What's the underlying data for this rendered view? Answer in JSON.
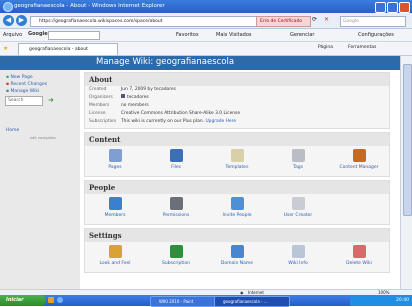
{
  "browser": {
    "title": "geografianaescola - About - Windows Internet Explorer",
    "url": "https://geografianaescola.wikispaces.com/space/about",
    "cert_error": "Erro de Certificado",
    "search_placeholder": "Google",
    "google_label": "Google",
    "tab_label": "geografianaescola - about",
    "favoritos": "Favoritos",
    "mais_visitados": "Mais Visitados",
    "gerenciar": "Gerenciar",
    "configuracoes": "Configurações",
    "arquivo": "Arquivo",
    "pagina": "Página",
    "ferramentas": "Ferramentas"
  },
  "wiki": {
    "header_title": "Manage Wiki: geografianaescola",
    "sidebar": {
      "items": [
        {
          "label": "New Page"
        },
        {
          "label": "Recent Changes"
        },
        {
          "label": "Manage Wiki"
        }
      ],
      "search_placeholder": "Search",
      "home_label": "Home",
      "edit_navigation": "edit navigation"
    },
    "about": {
      "heading": "About",
      "rows": [
        {
          "key": "Created",
          "value": "Jun 7, 2009 by tecadores"
        },
        {
          "key": "Organizers",
          "value": "tecadores"
        },
        {
          "key": "Members",
          "value": "no members"
        },
        {
          "key": "License",
          "value": "Creative Commons Attribution Share-Alike 3.0 License"
        },
        {
          "key": "Subscription",
          "value": "This wiki is currently on our Plus plan.",
          "link": "Upgrade Here"
        }
      ]
    },
    "content": {
      "heading": "Content",
      "items": [
        {
          "label": "Pages",
          "color": "#7f9fd1"
        },
        {
          "label": "Files",
          "color": "#3b6fb6"
        },
        {
          "label": "Templates",
          "color": "#d9d0a8"
        },
        {
          "label": "Tags",
          "color": "#b9bdc4"
        },
        {
          "label": "Content Manager",
          "color": "#c56a1f"
        }
      ]
    },
    "people": {
      "heading": "People",
      "items": [
        {
          "label": "Members",
          "color": "#3b7fd1"
        },
        {
          "label": "Permissions",
          "color": "#6b6f7a"
        },
        {
          "label": "Invite People",
          "color": "#4f8fd6"
        },
        {
          "label": "User Creator",
          "color": "#c9ccd2"
        }
      ]
    },
    "settings": {
      "heading": "Settings",
      "items": [
        {
          "label": "Look and Feel",
          "color": "#d9a232"
        },
        {
          "label": "Subscription",
          "color": "#2f8f3a"
        },
        {
          "label": "Domain Name",
          "color": "#4a86d0"
        },
        {
          "label": "Wiki Info",
          "color": "#b8c6d8"
        },
        {
          "label": "Delete Wiki",
          "color": "#d86a6a"
        }
      ]
    }
  },
  "statusbar": {
    "zone": "Internet",
    "zoom": "100%"
  },
  "taskbar": {
    "start": "Iniciar",
    "tasks": [
      "WIKI 2010 - Paint",
      "geografianaescola - ..."
    ],
    "clock": "20:40"
  }
}
